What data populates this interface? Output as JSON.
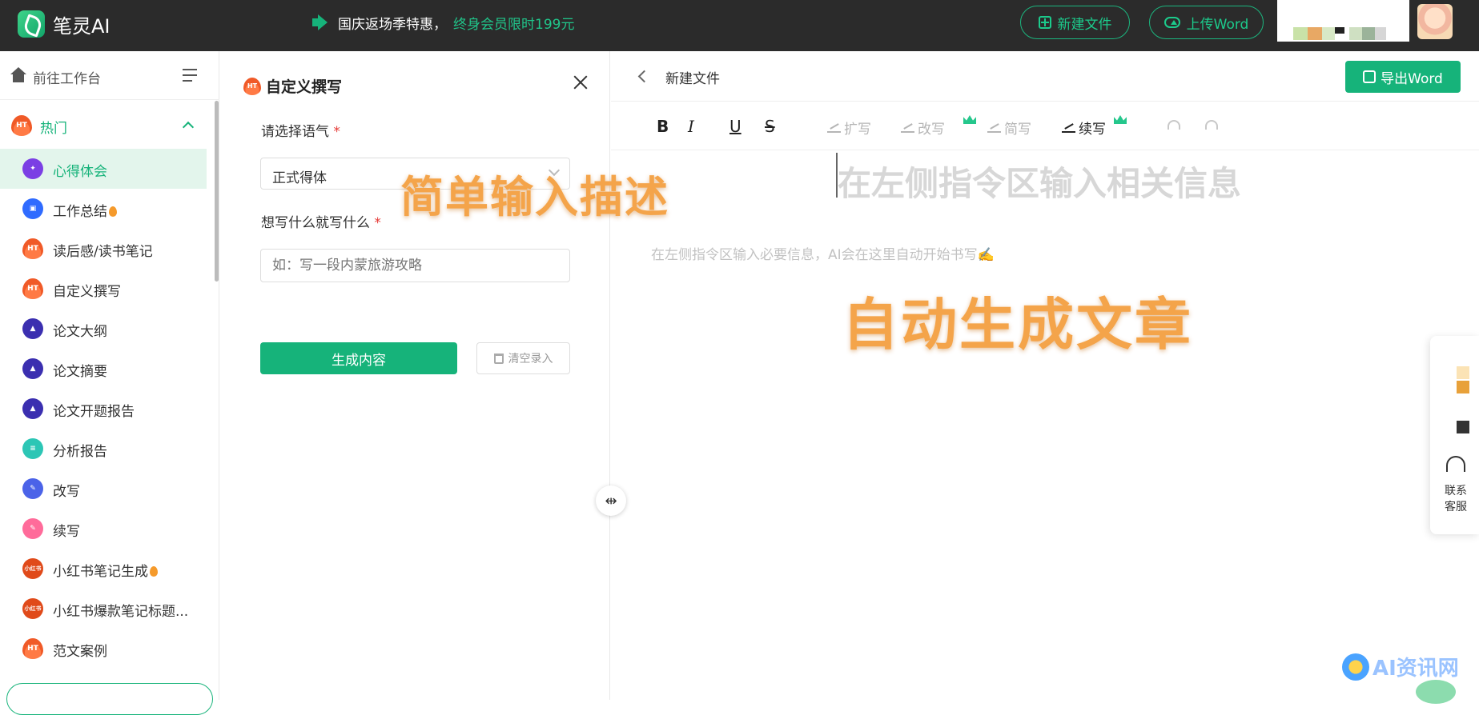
{
  "topbar": {
    "app_name": "笔灵AI",
    "promo_text": "国庆返场季特惠，",
    "promo_highlight": "终身会员限时199元",
    "new_file_label": "新建文件",
    "upload_word_label": "上传Word"
  },
  "sidebar": {
    "header_label": "前往工作台",
    "group_label": "热门",
    "items": [
      {
        "label": "心得体会",
        "icon": "badge-icon",
        "hot": false
      },
      {
        "label": "工作总结",
        "icon": "briefcase-icon",
        "hot": true
      },
      {
        "label": "读后感/读书笔记",
        "icon": "hot-flame-icon",
        "hot": false
      },
      {
        "label": "自定义撰写",
        "icon": "hot-flame-icon",
        "hot": false
      },
      {
        "label": "论文大纲",
        "icon": "graduation-cap-icon",
        "hot": false
      },
      {
        "label": "论文摘要",
        "icon": "graduation-cap-icon",
        "hot": false
      },
      {
        "label": "论文开题报告",
        "icon": "graduation-cap-icon",
        "hot": false
      },
      {
        "label": "分析报告",
        "icon": "document-icon",
        "hot": false
      },
      {
        "label": "改写",
        "icon": "magic-wand-icon",
        "hot": false
      },
      {
        "label": "续写",
        "icon": "pen-icon",
        "hot": false
      },
      {
        "label": "小红书笔记生成",
        "icon": "xiaohongshu-icon",
        "hot": true
      },
      {
        "label": "小红书爆款笔记标题...",
        "icon": "xiaohongshu-icon",
        "hot": false
      },
      {
        "label": "范文案例",
        "icon": "hot-flame-icon",
        "hot": false
      }
    ],
    "icon_text": {
      "hot": "HT",
      "xhs": "小红书"
    }
  },
  "form": {
    "title": "自定义撰写",
    "tone_label": "请选择语气",
    "tone_value": "正式得体",
    "topic_label": "想写什么就写什么",
    "topic_placeholder": "如：写一段内蒙旅游攻略",
    "required_mark": "*",
    "generate_label": "生成内容",
    "clear_label": "清空录入"
  },
  "editor": {
    "doc_title": "新建文件",
    "export_label": "导出Word",
    "toolbar": {
      "bold": "B",
      "italic": "I",
      "underline": "U",
      "strike": "S",
      "expand": "扩写",
      "rewrite": "改写",
      "simplify": "简写",
      "continue": "续写"
    },
    "title_placeholder": "在左侧指令区输入相关信息",
    "body_placeholder": "在左侧指令区输入必要信息，AI会在这里自动开始书写✍️"
  },
  "overlays": {
    "left": "简单输入描述",
    "right": "自动生成文章"
  },
  "right_widget": {
    "support_label": "联系客服"
  },
  "watermark": "AI资讯网",
  "colors": {
    "brand_green": "#16b37a",
    "topbar": "#2b2b2b",
    "overlay_orange": "#f4a44a"
  }
}
